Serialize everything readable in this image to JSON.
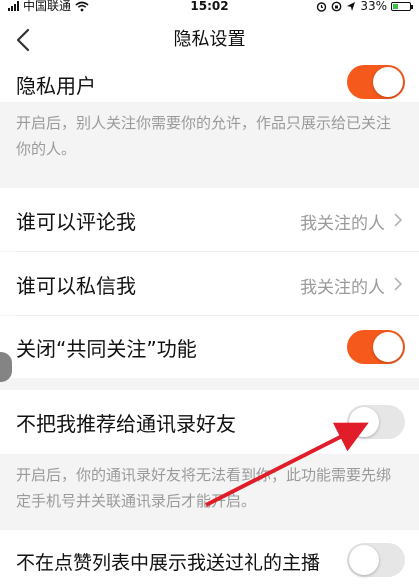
{
  "status_bar": {
    "carrier": "中国联通",
    "time": "15:02",
    "battery_text": "33%",
    "battery_level": 0.33,
    "icons": [
      "signal-icon",
      "wifi-icon",
      "alarm-icon",
      "rotation-lock-icon",
      "location-icon",
      "battery-icon"
    ]
  },
  "nav": {
    "title": "隐私设置",
    "back_icon": "chevron-left-icon"
  },
  "settings": {
    "private_user": {
      "label": "隐私用户",
      "enabled": true
    },
    "private_user_note": "开启后，别人关注你需要你的允许，作品只展示给已关注你的人。",
    "who_can_comment": {
      "label": "谁可以评论我",
      "value": "我关注的人"
    },
    "who_can_message": {
      "label": "谁可以私信我",
      "value": "我关注的人"
    },
    "close_mutual_follow": {
      "label": "关闭“共同关注”功能",
      "enabled": true
    },
    "no_recommend_contacts": {
      "label": "不把我推荐给通讯录好友",
      "enabled": false
    },
    "no_recommend_contacts_note": "开启后，你的通讯录好友将无法看到你；此功能需要先绑定手机号并关联通讯录后才能开启。",
    "hide_gifted_streamers": {
      "label": "不在点赞列表中展示我送过礼的主播",
      "enabled": false
    }
  },
  "colors": {
    "accent": "#f55a1c",
    "toggle_off": "#e6e6e6",
    "annotation_arrow": "#e11d2a",
    "secondary_text": "#9a9a9a"
  }
}
